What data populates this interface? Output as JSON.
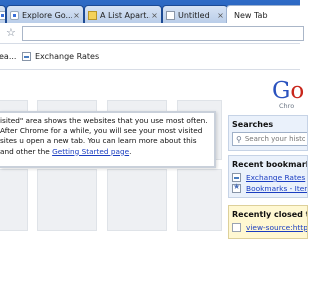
{
  "tabs": [
    {
      "label": "",
      "icon": "google-favicon-icon",
      "active": false
    },
    {
      "label": "Explore Go...",
      "icon": "google-favicon-icon",
      "active": false
    },
    {
      "label": "A List Apart...",
      "icon": "document-favicon-icon",
      "active": false
    },
    {
      "label": "Untitled",
      "icon": "page-favicon-icon",
      "active": false
    },
    {
      "label": "New Tab",
      "icon": "",
      "active": true
    }
  ],
  "tab_close_glyph": "×",
  "toolbar": {
    "star_glyph": "☆",
    "omnibox_value": ""
  },
  "bookmark_bar": {
    "items": [
      {
        "label": "ea..."
      },
      {
        "label": "Exchange Rates"
      }
    ]
  },
  "notice": {
    "text": "isited\" area shows the websites that you use most often. After Chrome for a while, you will see your most visited sites u open a new tab. You can learn more about this and other the ",
    "link": "Getting Started page",
    "suffix": "."
  },
  "logo": {
    "g1": "G",
    "g2": "o",
    "sub": "Chro"
  },
  "searches": {
    "title": "Searches",
    "placeholder": "Search your histo"
  },
  "recent_bookmarks": {
    "title": "Recent bookmarks",
    "items": [
      {
        "label": "Exchange Rates"
      },
      {
        "label": "Bookmarks - Items (\""
      }
    ]
  },
  "recently_closed": {
    "title": "Recently closed ta",
    "items": [
      {
        "label": "view-source:http:/"
      }
    ]
  },
  "colors": {
    "tabstrip": "#2e6bc6",
    "link": "#1a3dc1",
    "panel_bg": "#eaf1fb",
    "recent_bg": "#fff8d2"
  }
}
